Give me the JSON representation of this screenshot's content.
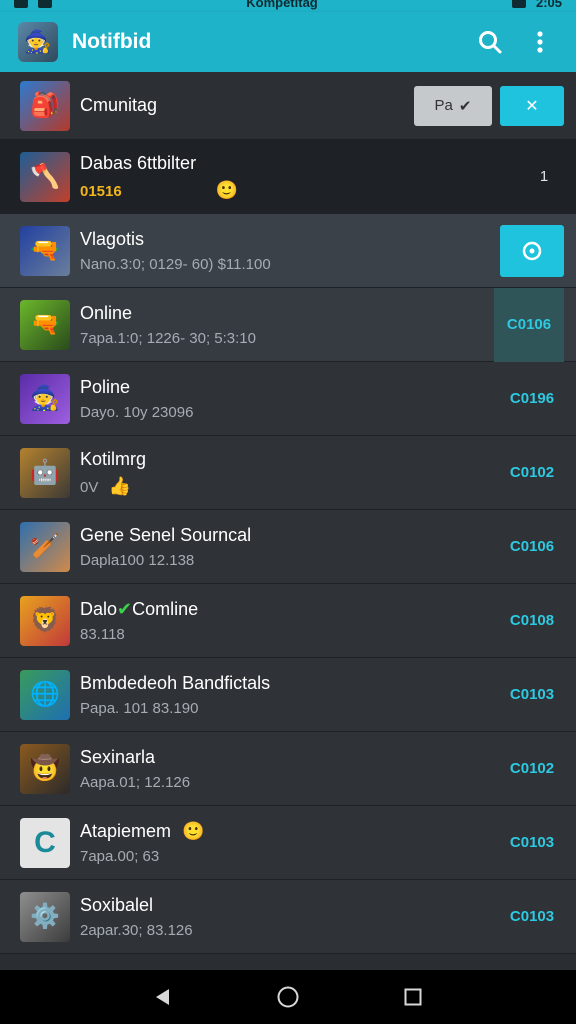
{
  "status": {
    "left_text": "",
    "center_text": "Kompetitag",
    "time": "2:05"
  },
  "app_bar": {
    "title": "Notifbid",
    "search_icon": "search-icon",
    "more_icon": "more-vert-icon"
  },
  "colors": {
    "accent": "#1fb3c9",
    "value_text": "#2ec9e0",
    "background": "#2a2e33"
  },
  "header_row": {
    "title": "Cmunitag",
    "gray_button_label": "Pa",
    "cyan_button_label": "✕"
  },
  "rows": [
    {
      "title": "Dabas 6ttbilter",
      "sub": "01516",
      "emoji": "🙂",
      "count": "1",
      "icon": "🪓",
      "bg": "linear-gradient(135deg,#1d5e96,#c2402a)"
    },
    {
      "title": "Vlagotis",
      "sub": "Nano.3:0; 0129- 60) $11.100",
      "icon": "🔫",
      "bg": "linear-gradient(135deg,#2240a0,#6a7f9c)"
    },
    {
      "title": "Online",
      "sub": "7apa.1:0; 1226- 30; 5:3:10",
      "value": "C0106",
      "icon": "🔫",
      "bg": "linear-gradient(135deg,#6bb72b,#2a4a1c)"
    },
    {
      "title": "Poline",
      "sub": "Dayo. 10y 23096",
      "value": "C0196",
      "icon": "🧙",
      "bg": "linear-gradient(135deg,#5b2ca8,#9d5fe0)"
    },
    {
      "title": "Kotilmrg",
      "sub": "0V",
      "emoji": "👍",
      "value": "C0102",
      "icon": "🤖",
      "bg": "linear-gradient(135deg,#b4822e,#3d3a36)"
    },
    {
      "title": "Gene Senel Sourncal",
      "sub": "Dapla100 12.138",
      "value": "C0106",
      "icon": "🏏",
      "bg": "linear-gradient(135deg,#2f6fae,#d08a4a)"
    },
    {
      "title": "Dalo",
      "title_suffix": "Comline",
      "sub": "83.118",
      "value": "C0108",
      "icon": "🦁",
      "bg": "linear-gradient(135deg,#e8a21f,#c0393a)"
    },
    {
      "title": "Bmbdedeoh Bandfictals",
      "sub": "Papa. 101 83.190",
      "value": "C0103",
      "icon": "🌐",
      "bg": "linear-gradient(135deg,#3a9b5c,#1e6fb0)"
    },
    {
      "title": "Sexinarla",
      "sub": "Aapa.01; 12.126",
      "value": "C0102",
      "icon": "🤠",
      "bg": "linear-gradient(135deg,#8a5a1f,#2c2a2a)"
    },
    {
      "title": "Atapiemem",
      "sub": "7apa.00; 63",
      "emoji": "🙂",
      "value": "C0103",
      "icon": "C",
      "bg": "#e4e4e4"
    },
    {
      "title": "Soxibalel",
      "sub": "2apar.30; 83.126",
      "value": "C0103",
      "icon": "⚙️",
      "bg": "linear-gradient(135deg,#8f8f8f,#3c3c3c)"
    }
  ],
  "nav": {
    "back": "back-icon",
    "home": "home-icon",
    "recents": "recents-icon"
  }
}
